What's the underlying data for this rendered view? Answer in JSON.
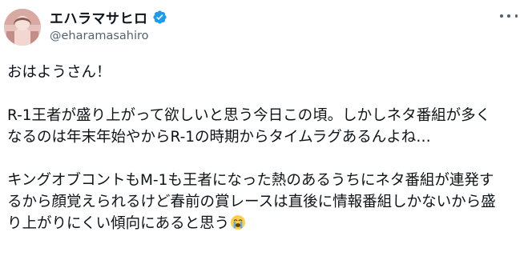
{
  "author": {
    "display_name": "エハラマサヒロ",
    "handle": "@eharamasahiro",
    "avatar_icon": "avatar-photo",
    "verified_icon": "verified-badge-icon",
    "verified_color": "#1d9bf0"
  },
  "menu": {
    "icon": "more-options-icon"
  },
  "post": {
    "greeting": "おはようさん！",
    "paragraph2": [
      "R-1王者が盛り上がって欲しいと思う今日この頃。しかしネタ番組が多く",
      "なるのは年末年始やからR-1の時期からタイムラグあるんよね…"
    ],
    "paragraph3": [
      "キングオブコントもM-1も王者になった熱のあるうちにネタ番組が連発す",
      "るから顔覚えられるけど春前の賞レースは直後に情報番組しかないから盛",
      "り上がりにくい傾向にあると思う"
    ],
    "trailing_emoji": "crying-face-emoji"
  }
}
